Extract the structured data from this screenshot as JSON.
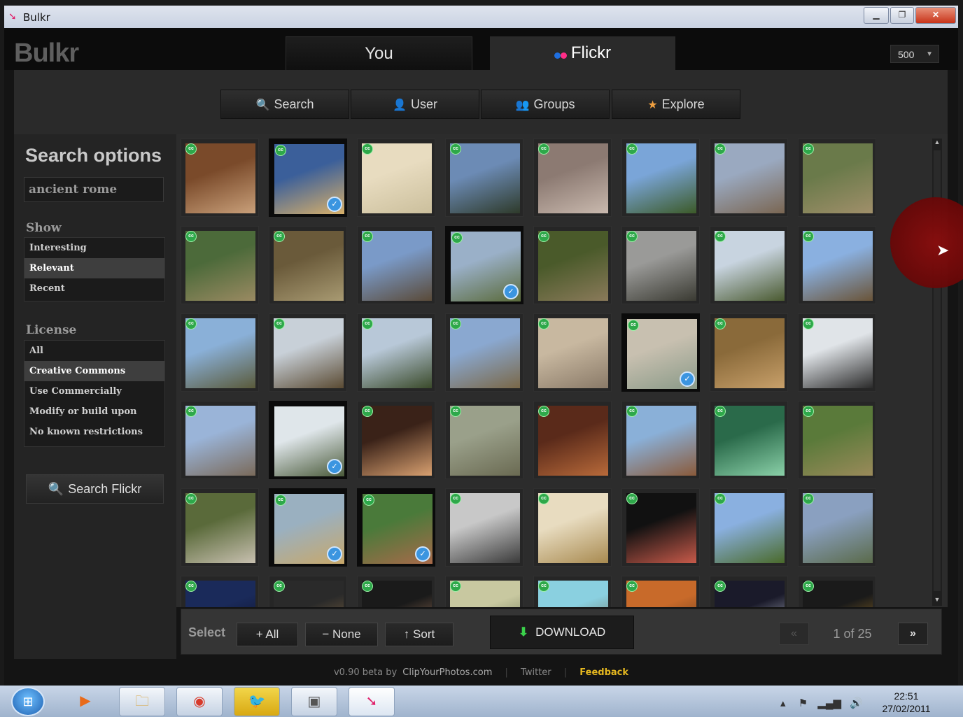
{
  "window": {
    "title": "Bulkr"
  },
  "app": {
    "logo": "Bulkr",
    "tabs": [
      {
        "label": "You"
      },
      {
        "label": "Flickr"
      }
    ],
    "count": "500"
  },
  "subnav": [
    {
      "label": "Search",
      "icon": "magnifier-icon"
    },
    {
      "label": "User",
      "icon": "user-icon"
    },
    {
      "label": "Groups",
      "icon": "groups-icon"
    },
    {
      "label": "Explore",
      "icon": "explore-star-icon"
    }
  ],
  "sidebar": {
    "heading": "Search options",
    "query": "ancient rome",
    "show_label": "Show",
    "show_options": [
      "Interesting",
      "Relevant",
      "Recent"
    ],
    "show_selected": 1,
    "license_label": "License",
    "license_options": [
      "All",
      "Creative Commons",
      "Use Commercially",
      "Modify or build upon",
      "No known restrictions"
    ],
    "license_selected": 1,
    "search_button": "Search Flickr"
  },
  "grid": {
    "photos": [
      {
        "colors": [
          "#7a4a2a",
          "#c9a07a"
        ],
        "cc": true,
        "selected": false
      },
      {
        "colors": [
          "#3b5f9a",
          "#d8b06a"
        ],
        "cc": true,
        "selected": true
      },
      {
        "colors": [
          "#e8dcc0",
          "#cbbf9c"
        ],
        "cc": true,
        "selected": false
      },
      {
        "colors": [
          "#6c8bb5",
          "#2e3a2a"
        ],
        "cc": true,
        "selected": false
      },
      {
        "colors": [
          "#8c7a72",
          "#c9b9ae"
        ],
        "cc": true,
        "selected": false
      },
      {
        "colors": [
          "#7aa5d8",
          "#3c5a28"
        ],
        "cc": true,
        "selected": false
      },
      {
        "colors": [
          "#9aa9c0",
          "#7a6652"
        ],
        "cc": true,
        "selected": false
      },
      {
        "colors": [
          "#6a7a4a",
          "#a08f6a"
        ],
        "cc": true,
        "selected": false
      },
      {
        "colors": [
          "#4c6a3a",
          "#9a8a62"
        ],
        "cc": true,
        "selected": false
      },
      {
        "colors": [
          "#6a5a3a",
          "#a89a72"
        ],
        "cc": true,
        "selected": false
      },
      {
        "colors": [
          "#7a9ac8",
          "#5a4a38"
        ],
        "cc": true,
        "selected": false
      },
      {
        "colors": [
          "#9ab0c8",
          "#5a6a3a"
        ],
        "cc": true,
        "selected": true
      },
      {
        "colors": [
          "#4a5a2a",
          "#8a7a5a"
        ],
        "cc": true,
        "selected": false
      },
      {
        "colors": [
          "#9a9a98",
          "#3a3a32"
        ],
        "cc": true,
        "selected": false
      },
      {
        "colors": [
          "#c8d4e0",
          "#4a5a30"
        ],
        "cc": true,
        "selected": false
      },
      {
        "colors": [
          "#8ab0e0",
          "#6a5438"
        ],
        "cc": true,
        "selected": false
      },
      {
        "colors": [
          "#8ab0d8",
          "#5a5a3a"
        ],
        "cc": true,
        "selected": false
      },
      {
        "colors": [
          "#c8d0d8",
          "#5a4a32"
        ],
        "cc": true,
        "selected": false
      },
      {
        "colors": [
          "#b8c8d8",
          "#3a4a2a"
        ],
        "cc": true,
        "selected": false
      },
      {
        "colors": [
          "#8aa8d0",
          "#7a6848"
        ],
        "cc": true,
        "selected": false
      },
      {
        "colors": [
          "#c8b8a0",
          "#8a7a68"
        ],
        "cc": true,
        "selected": false
      },
      {
        "colors": [
          "#c8c0b0",
          "#8a9a88"
        ],
        "cc": true,
        "selected": true
      },
      {
        "colors": [
          "#8a6a3a",
          "#c8a06a"
        ],
        "cc": true,
        "selected": false
      },
      {
        "colors": [
          "#e0e4e8",
          "#2a2a2a"
        ],
        "cc": true,
        "selected": false
      },
      {
        "colors": [
          "#9ab4d8",
          "#7a6a5a"
        ],
        "cc": true,
        "selected": false
      },
      {
        "colors": [
          "#dfe6ea",
          "#4a5a3a"
        ],
        "cc": false,
        "selected": true
      },
      {
        "colors": [
          "#3a2218",
          "#d8a070"
        ],
        "cc": true,
        "selected": false
      },
      {
        "colors": [
          "#9aa08a",
          "#6a6a52"
        ],
        "cc": true,
        "selected": false
      },
      {
        "colors": [
          "#5a2a1a",
          "#b86a3a"
        ],
        "cc": true,
        "selected": false
      },
      {
        "colors": [
          "#8ab0d8",
          "#8a5a3a"
        ],
        "cc": true,
        "selected": false
      },
      {
        "colors": [
          "#2a6a4a",
          "#8ad0a8"
        ],
        "cc": true,
        "selected": false
      },
      {
        "colors": [
          "#5a7a3a",
          "#9a8a5a"
        ],
        "cc": true,
        "selected": false
      },
      {
        "colors": [
          "#5a6a3a",
          "#c8c0b0"
        ],
        "cc": true,
        "selected": false
      },
      {
        "colors": [
          "#9ab0c0",
          "#c8a86a"
        ],
        "cc": true,
        "selected": true
      },
      {
        "colors": [
          "#4a7a3a",
          "#a86a4a"
        ],
        "cc": true,
        "selected": true
      },
      {
        "colors": [
          "#c8c8c8",
          "#3a3a3a"
        ],
        "cc": true,
        "selected": false
      },
      {
        "colors": [
          "#e8dcc0",
          "#a88a50"
        ],
        "cc": true,
        "selected": false
      },
      {
        "colors": [
          "#111111",
          "#c85a4a"
        ],
        "cc": true,
        "selected": false
      },
      {
        "colors": [
          "#8ab0e0",
          "#4a6a2a"
        ],
        "cc": true,
        "selected": false
      },
      {
        "colors": [
          "#8aa0c0",
          "#5a6a4a"
        ],
        "cc": true,
        "selected": false
      },
      {
        "colors": [
          "#1a2a5a",
          "#0a0a1a"
        ],
        "cc": true,
        "selected": false
      },
      {
        "colors": [
          "#2a2a2a",
          "#a07a4a"
        ],
        "cc": true,
        "selected": false
      },
      {
        "colors": [
          "#1a1a1a",
          "#c8906a"
        ],
        "cc": true,
        "selected": false
      },
      {
        "colors": [
          "#c8c8a0",
          "#4a5a3a"
        ],
        "cc": true,
        "selected": false
      },
      {
        "colors": [
          "#8ad0e0",
          "#6a4a2a"
        ],
        "cc": true,
        "selected": false
      },
      {
        "colors": [
          "#c86a2a",
          "#3a2a1a"
        ],
        "cc": true,
        "selected": false
      },
      {
        "colors": [
          "#1a1a2a",
          "#e8f0ff"
        ],
        "cc": true,
        "selected": false
      },
      {
        "colors": [
          "#1a1a1a",
          "#c8902a"
        ],
        "cc": true,
        "selected": false
      }
    ]
  },
  "toolbar": {
    "select_label": "Select",
    "all_label": "+ All",
    "none_label": "− None",
    "sort_label": "↑ Sort",
    "download_label": "DOWNLOAD",
    "prev_label": "«",
    "page_label": "1 of 25",
    "next_label": "»"
  },
  "footer": {
    "version": "v0.90 beta by",
    "site": "ClipYourPhotos.com",
    "twitter": "Twitter",
    "feedback": "Feedback"
  },
  "taskbar": {
    "time": "22:51",
    "date": "27/02/2011"
  },
  "colors": {
    "accent_green": "#3ad04a",
    "feedback": "#e4b71f",
    "selected_check": "#3b95e0"
  }
}
